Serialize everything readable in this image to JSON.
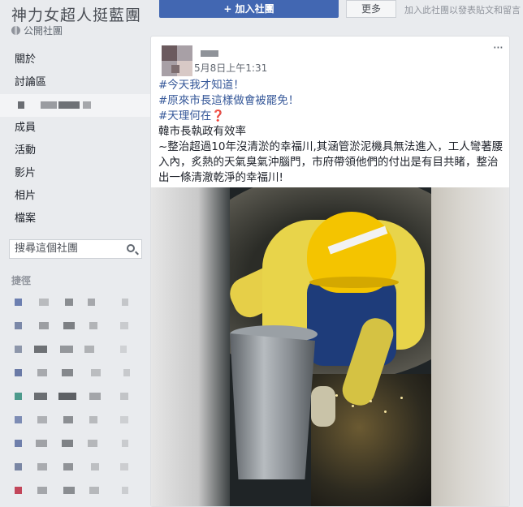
{
  "sidebar": {
    "group_name": "神力女超人挺藍團",
    "privacy": "公開社團",
    "nav": {
      "about": "關於",
      "discussion": "討論區",
      "members": "成員",
      "events": "活動",
      "videos": "影片",
      "photos": "相片",
      "files": "檔案"
    },
    "search_placeholder": "搜尋這個社團",
    "shortcuts_title": "捷徑"
  },
  "actions": {
    "join_label": "+ 加入社團",
    "more_label": "更多",
    "hint": "加入此社團以發表貼文和留言"
  },
  "post": {
    "timestamp": "5月8日上午1:31",
    "more_icon": "···",
    "tag1": "#今天我才知道！",
    "tag2": "#原來市長這樣做會被罷免！",
    "tag3": "#天理何在",
    "question_mark": "❓",
    "line4": "韓市長執政有效率",
    "body": "~整治超過10年沒清淤的幸福川,其涵管淤泥機具無法進入，工人彎著腰入內，炙熱的天氣臭氣沖腦門，市府帶領他們的付出是有目共睹，整治出一條清澈乾淨的幸福川!"
  },
  "colors": {
    "brand": "#4267b2",
    "link": "#365899",
    "page_bg": "#e9ebee"
  }
}
